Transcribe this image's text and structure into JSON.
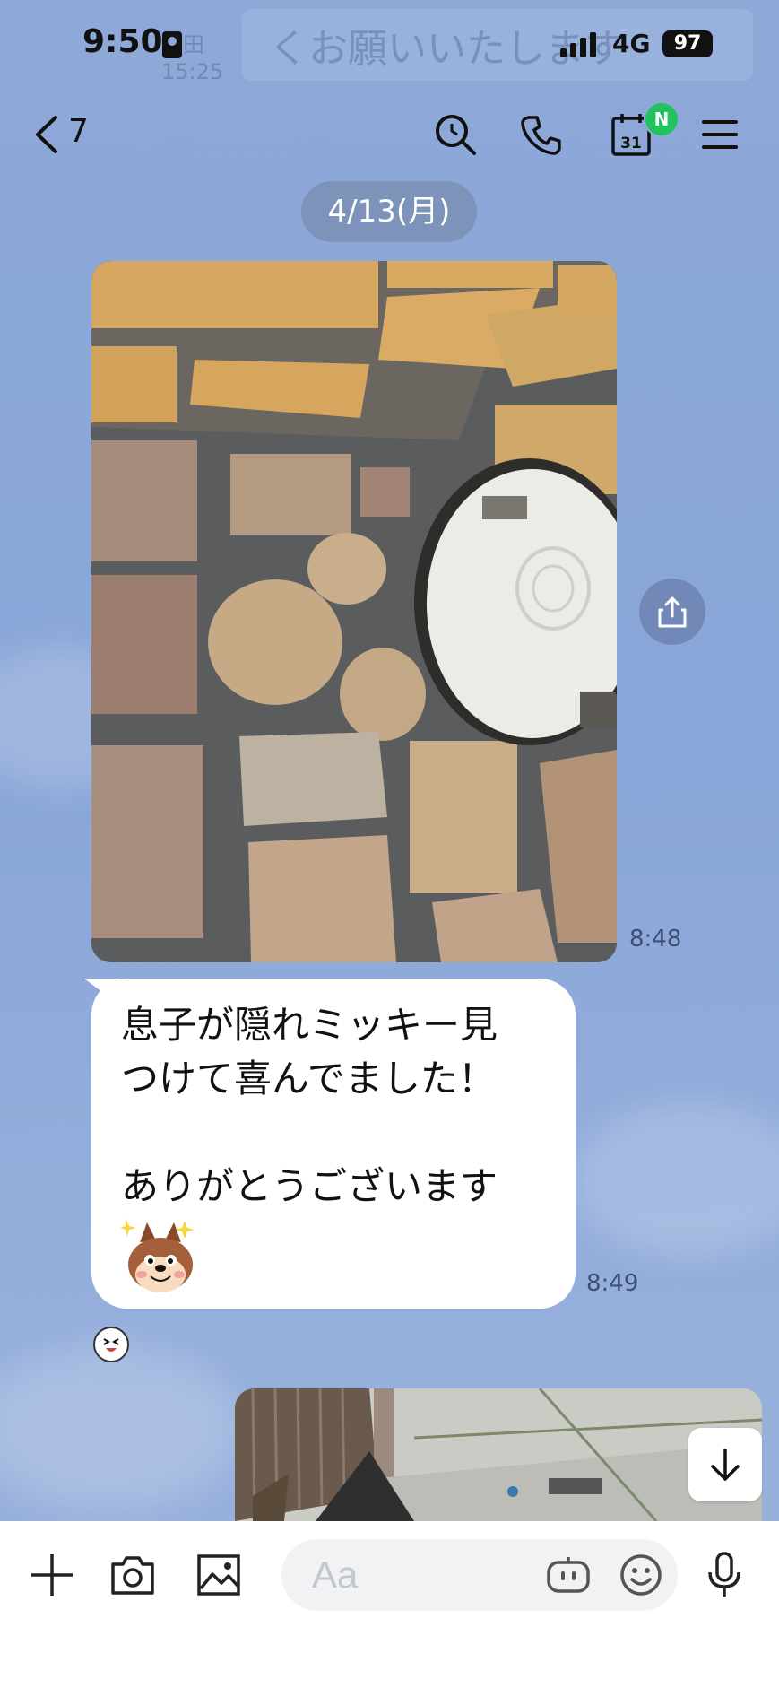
{
  "status_bar": {
    "time": "9:50",
    "network": "4G",
    "battery": "97",
    "background_notification": "くお願いいたします",
    "background_sender": "太田",
    "background_time": "15:25"
  },
  "header": {
    "back_count": "7",
    "calendar_day": "31",
    "new_badge": "N"
  },
  "chat": {
    "date_chip": "4/13(月)",
    "messages": [
      {
        "type": "image",
        "time": "8:48"
      },
      {
        "type": "text",
        "text": "息子が隠れミッキー見\nつけて喜んでました！\n\nありがとうございます",
        "time": "8:49"
      }
    ]
  },
  "input": {
    "placeholder": "Aa"
  },
  "colors": {
    "background": "#8ea9d8",
    "date_chip": "#7e93b9",
    "badge": "#22c35e",
    "bubble": "#ffffff"
  },
  "icons": [
    "chevron-left-icon",
    "search-icon",
    "phone-icon",
    "calendar-icon",
    "menu-icon",
    "share-icon",
    "arrow-down-icon",
    "plus-icon",
    "camera-icon",
    "image-icon",
    "bot-icon",
    "emoji-icon",
    "microphone-icon"
  ]
}
